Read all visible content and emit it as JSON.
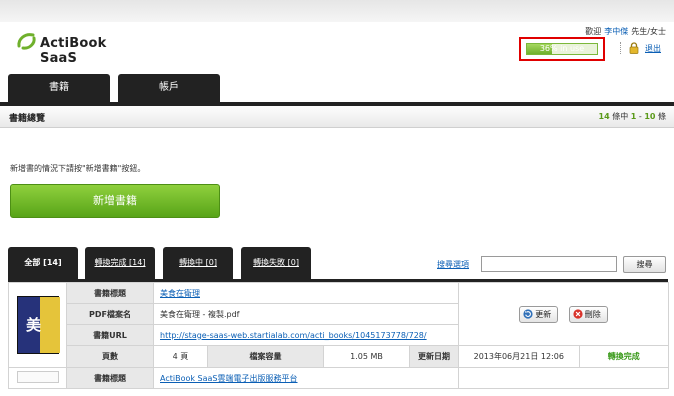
{
  "brand": {
    "name": "ActiBook SaaS"
  },
  "header": {
    "welcome": "歡迎",
    "user_name": "李中傑",
    "honorific": "先生/女士",
    "usage_text": "36% in use",
    "usage_percent": 36,
    "logout": "退出"
  },
  "nav": {
    "tabs": [
      {
        "label": "書籍"
      },
      {
        "label": "帳戶"
      }
    ]
  },
  "section": {
    "title": "書籍總覽",
    "total_count": "14",
    "count_mid": " 條中 ",
    "range_start": "1",
    "range_sep": " - ",
    "range_end": "10",
    "count_suffix": " 條"
  },
  "instruction": "新增書的情況下請按\"新增書籍\"按鈕。",
  "add_button": "新增書籍",
  "filters": [
    {
      "label": "全部 [14]"
    },
    {
      "label": "轉換完成 [14]"
    },
    {
      "label": "轉換中 [0]"
    },
    {
      "label": "轉換失敗 [0]"
    }
  ],
  "search": {
    "options_link": "搜尋選項",
    "input_value": "",
    "button_label": "搜尋"
  },
  "table_labels": {
    "title": "書籍標題",
    "pdf_name": "PDF檔案名",
    "url": "書籍URL",
    "pages": "頁數",
    "file_size": "檔案容量",
    "updated": "更新日期"
  },
  "books": [
    {
      "title": "美食在衛理",
      "pdf_name": "美食在衛理 - 複製.pdf",
      "url": "http://stage-saas-web.startialab.com/acti_books/1045173778/728/",
      "pages": "4 頁",
      "file_size": "1.05 MB",
      "updated": "2013年06月21日 12:06",
      "status": "轉換完成",
      "update_label": "更新",
      "delete_label": "刪除"
    },
    {
      "title": "ActiBook SaaS雲端電子出版服務平台"
    }
  ],
  "colors": {
    "accent_green": "#6fb02c",
    "link_blue": "#0b5fb5",
    "highlight_red": "#e00000",
    "dark_tab": "#222222"
  },
  "icons": [
    "logo-icon",
    "lock-icon",
    "refresh-icon",
    "delete-icon"
  ]
}
